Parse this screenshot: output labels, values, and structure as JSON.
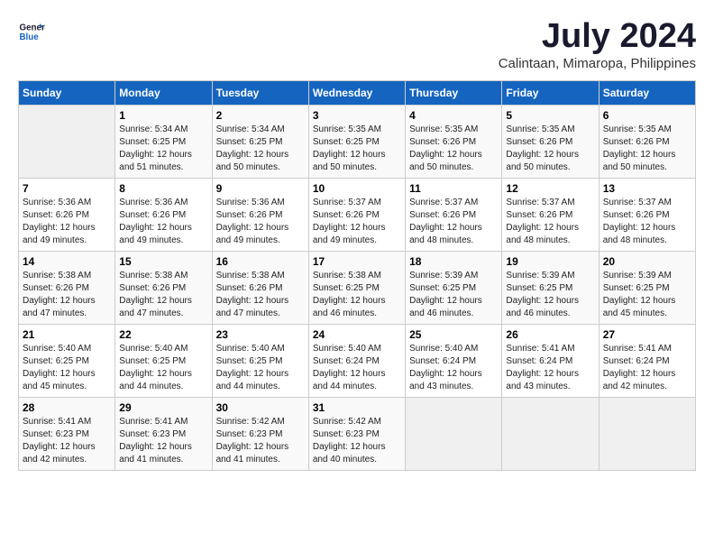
{
  "header": {
    "logo_general": "General",
    "logo_blue": "Blue",
    "month_year": "July 2024",
    "location": "Calintaan, Mimaropa, Philippines"
  },
  "weekdays": [
    "Sunday",
    "Monday",
    "Tuesday",
    "Wednesday",
    "Thursday",
    "Friday",
    "Saturday"
  ],
  "weeks": [
    [
      {
        "day": "",
        "sunrise": "",
        "sunset": "",
        "daylight": ""
      },
      {
        "day": "1",
        "sunrise": "Sunrise: 5:34 AM",
        "sunset": "Sunset: 6:25 PM",
        "daylight": "Daylight: 12 hours and 51 minutes."
      },
      {
        "day": "2",
        "sunrise": "Sunrise: 5:34 AM",
        "sunset": "Sunset: 6:25 PM",
        "daylight": "Daylight: 12 hours and 50 minutes."
      },
      {
        "day": "3",
        "sunrise": "Sunrise: 5:35 AM",
        "sunset": "Sunset: 6:25 PM",
        "daylight": "Daylight: 12 hours and 50 minutes."
      },
      {
        "day": "4",
        "sunrise": "Sunrise: 5:35 AM",
        "sunset": "Sunset: 6:26 PM",
        "daylight": "Daylight: 12 hours and 50 minutes."
      },
      {
        "day": "5",
        "sunrise": "Sunrise: 5:35 AM",
        "sunset": "Sunset: 6:26 PM",
        "daylight": "Daylight: 12 hours and 50 minutes."
      },
      {
        "day": "6",
        "sunrise": "Sunrise: 5:35 AM",
        "sunset": "Sunset: 6:26 PM",
        "daylight": "Daylight: 12 hours and 50 minutes."
      }
    ],
    [
      {
        "day": "7",
        "sunrise": "Sunrise: 5:36 AM",
        "sunset": "Sunset: 6:26 PM",
        "daylight": "Daylight: 12 hours and 49 minutes."
      },
      {
        "day": "8",
        "sunrise": "Sunrise: 5:36 AM",
        "sunset": "Sunset: 6:26 PM",
        "daylight": "Daylight: 12 hours and 49 minutes."
      },
      {
        "day": "9",
        "sunrise": "Sunrise: 5:36 AM",
        "sunset": "Sunset: 6:26 PM",
        "daylight": "Daylight: 12 hours and 49 minutes."
      },
      {
        "day": "10",
        "sunrise": "Sunrise: 5:37 AM",
        "sunset": "Sunset: 6:26 PM",
        "daylight": "Daylight: 12 hours and 49 minutes."
      },
      {
        "day": "11",
        "sunrise": "Sunrise: 5:37 AM",
        "sunset": "Sunset: 6:26 PM",
        "daylight": "Daylight: 12 hours and 48 minutes."
      },
      {
        "day": "12",
        "sunrise": "Sunrise: 5:37 AM",
        "sunset": "Sunset: 6:26 PM",
        "daylight": "Daylight: 12 hours and 48 minutes."
      },
      {
        "day": "13",
        "sunrise": "Sunrise: 5:37 AM",
        "sunset": "Sunset: 6:26 PM",
        "daylight": "Daylight: 12 hours and 48 minutes."
      }
    ],
    [
      {
        "day": "14",
        "sunrise": "Sunrise: 5:38 AM",
        "sunset": "Sunset: 6:26 PM",
        "daylight": "Daylight: 12 hours and 47 minutes."
      },
      {
        "day": "15",
        "sunrise": "Sunrise: 5:38 AM",
        "sunset": "Sunset: 6:26 PM",
        "daylight": "Daylight: 12 hours and 47 minutes."
      },
      {
        "day": "16",
        "sunrise": "Sunrise: 5:38 AM",
        "sunset": "Sunset: 6:26 PM",
        "daylight": "Daylight: 12 hours and 47 minutes."
      },
      {
        "day": "17",
        "sunrise": "Sunrise: 5:38 AM",
        "sunset": "Sunset: 6:25 PM",
        "daylight": "Daylight: 12 hours and 46 minutes."
      },
      {
        "day": "18",
        "sunrise": "Sunrise: 5:39 AM",
        "sunset": "Sunset: 6:25 PM",
        "daylight": "Daylight: 12 hours and 46 minutes."
      },
      {
        "day": "19",
        "sunrise": "Sunrise: 5:39 AM",
        "sunset": "Sunset: 6:25 PM",
        "daylight": "Daylight: 12 hours and 46 minutes."
      },
      {
        "day": "20",
        "sunrise": "Sunrise: 5:39 AM",
        "sunset": "Sunset: 6:25 PM",
        "daylight": "Daylight: 12 hours and 45 minutes."
      }
    ],
    [
      {
        "day": "21",
        "sunrise": "Sunrise: 5:40 AM",
        "sunset": "Sunset: 6:25 PM",
        "daylight": "Daylight: 12 hours and 45 minutes."
      },
      {
        "day": "22",
        "sunrise": "Sunrise: 5:40 AM",
        "sunset": "Sunset: 6:25 PM",
        "daylight": "Daylight: 12 hours and 44 minutes."
      },
      {
        "day": "23",
        "sunrise": "Sunrise: 5:40 AM",
        "sunset": "Sunset: 6:25 PM",
        "daylight": "Daylight: 12 hours and 44 minutes."
      },
      {
        "day": "24",
        "sunrise": "Sunrise: 5:40 AM",
        "sunset": "Sunset: 6:24 PM",
        "daylight": "Daylight: 12 hours and 44 minutes."
      },
      {
        "day": "25",
        "sunrise": "Sunrise: 5:40 AM",
        "sunset": "Sunset: 6:24 PM",
        "daylight": "Daylight: 12 hours and 43 minutes."
      },
      {
        "day": "26",
        "sunrise": "Sunrise: 5:41 AM",
        "sunset": "Sunset: 6:24 PM",
        "daylight": "Daylight: 12 hours and 43 minutes."
      },
      {
        "day": "27",
        "sunrise": "Sunrise: 5:41 AM",
        "sunset": "Sunset: 6:24 PM",
        "daylight": "Daylight: 12 hours and 42 minutes."
      }
    ],
    [
      {
        "day": "28",
        "sunrise": "Sunrise: 5:41 AM",
        "sunset": "Sunset: 6:23 PM",
        "daylight": "Daylight: 12 hours and 42 minutes."
      },
      {
        "day": "29",
        "sunrise": "Sunrise: 5:41 AM",
        "sunset": "Sunset: 6:23 PM",
        "daylight": "Daylight: 12 hours and 41 minutes."
      },
      {
        "day": "30",
        "sunrise": "Sunrise: 5:42 AM",
        "sunset": "Sunset: 6:23 PM",
        "daylight": "Daylight: 12 hours and 41 minutes."
      },
      {
        "day": "31",
        "sunrise": "Sunrise: 5:42 AM",
        "sunset": "Sunset: 6:23 PM",
        "daylight": "Daylight: 12 hours and 40 minutes."
      },
      {
        "day": "",
        "sunrise": "",
        "sunset": "",
        "daylight": ""
      },
      {
        "day": "",
        "sunrise": "",
        "sunset": "",
        "daylight": ""
      },
      {
        "day": "",
        "sunrise": "",
        "sunset": "",
        "daylight": ""
      }
    ]
  ]
}
